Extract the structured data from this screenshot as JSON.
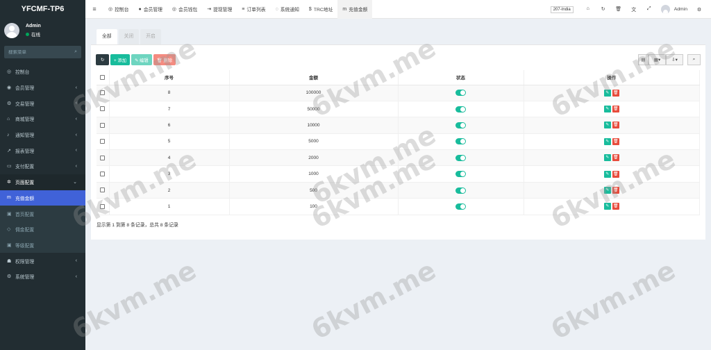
{
  "brand": "YFCMF-TP6",
  "user": {
    "name": "Admin",
    "status": "在线"
  },
  "sidebar_search": {
    "placeholder": "搜索菜单"
  },
  "menu": [
    {
      "label": "控制台",
      "icon": "dashboard-icon",
      "glyph": "◎",
      "chevron": false
    },
    {
      "label": "会员管理",
      "icon": "user-circle-icon",
      "glyph": "◉",
      "chevron": true
    },
    {
      "label": "交易管理",
      "icon": "cog-icon",
      "glyph": "⚙",
      "chevron": true
    },
    {
      "label": "商城管理",
      "icon": "home-icon",
      "glyph": "⌂",
      "chevron": true
    },
    {
      "label": "通知管理",
      "icon": "bell-icon",
      "glyph": "♪",
      "chevron": true
    },
    {
      "label": "报表管理",
      "icon": "chart-line-icon",
      "glyph": "↗",
      "chevron": true
    },
    {
      "label": "支付配置",
      "icon": "card-icon",
      "glyph": "▭",
      "chevron": true
    },
    {
      "label": "页面配置",
      "icon": "gear-icon",
      "glyph": "✲",
      "chevron": true,
      "open": true
    },
    {
      "label": "充值金额",
      "icon": "money-icon",
      "glyph": "m",
      "chevron": false,
      "active": true
    },
    {
      "label": "首页配置",
      "icon": "image-icon",
      "glyph": "▣",
      "chevron": false,
      "sub": true
    },
    {
      "label": "佣金配置",
      "icon": "diamond-icon",
      "glyph": "◇",
      "chevron": false,
      "sub": true
    },
    {
      "label": "等级配置",
      "icon": "picture-icon",
      "glyph": "▣",
      "chevron": false,
      "sub": true
    },
    {
      "label": "权限管理",
      "icon": "users-icon",
      "glyph": "☗",
      "chevron": true
    },
    {
      "label": "系统管理",
      "icon": "cogs-icon",
      "glyph": "⚙",
      "chevron": true
    }
  ],
  "nav_tabs": [
    {
      "label": "控制台",
      "icon": "dashboard-icon",
      "glyph": "◎"
    },
    {
      "label": "会员管理",
      "icon": "user-icon",
      "glyph": "●"
    },
    {
      "label": "会员钱包",
      "icon": "wallet-icon",
      "glyph": "◎"
    },
    {
      "label": "提现管理",
      "icon": "sign-out-icon",
      "glyph": "⇥"
    },
    {
      "label": "订单列表",
      "icon": "list-icon",
      "glyph": "≡"
    },
    {
      "label": "系统通知",
      "icon": "comments-icon",
      "glyph": "◌"
    },
    {
      "label": "TRC地址",
      "icon": "dollar-icon",
      "glyph": "$"
    },
    {
      "label": "充值金额",
      "icon": "money-icon",
      "glyph": "m",
      "active": true
    }
  ],
  "nav_right": {
    "region": "207-India",
    "icons": [
      {
        "name": "home-icon",
        "glyph": "⌂"
      },
      {
        "name": "refresh-icon",
        "glyph": "↻"
      },
      {
        "name": "trash-icon",
        "glyph": "🗑"
      },
      {
        "name": "translate-icon",
        "glyph": "文"
      },
      {
        "name": "fullscreen-icon",
        "glyph": "⤢"
      }
    ],
    "user": "Admin",
    "settings_glyph": "⚙"
  },
  "content_tabs": [
    "全部",
    "关闭",
    "开启"
  ],
  "toolbar": {
    "refresh": "↻",
    "add": "+ 添加",
    "edit": "✎ 编辑",
    "delete": "🗑 删除"
  },
  "toolbar_right": [
    {
      "name": "columns-icon",
      "glyph": "▤",
      "width": 15
    },
    {
      "name": "grid-icon",
      "glyph": "▦▾",
      "width": 25
    },
    {
      "name": "export-icon",
      "glyph": "⇩▾",
      "width": 25
    },
    {
      "name": "search-icon",
      "glyph": "⌕",
      "width": 19
    }
  ],
  "table": {
    "headers": [
      "序号",
      "金额",
      "状态",
      "操作"
    ],
    "rows": [
      {
        "id": "8",
        "amount": "100000"
      },
      {
        "id": "7",
        "amount": "50000"
      },
      {
        "id": "6",
        "amount": "10000"
      },
      {
        "id": "5",
        "amount": "5000"
      },
      {
        "id": "4",
        "amount": "2000"
      },
      {
        "id": "3",
        "amount": "1000"
      },
      {
        "id": "2",
        "amount": "500"
      },
      {
        "id": "1",
        "amount": "100"
      }
    ]
  },
  "summary": "显示第 1 到第 8 条记录，总共 8 条记录",
  "watermark": "6kvm.me"
}
